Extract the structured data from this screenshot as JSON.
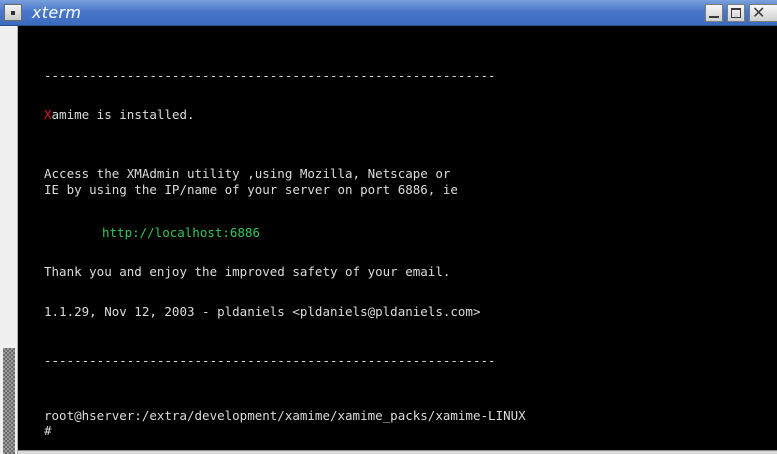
{
  "window": {
    "title": "xterm"
  },
  "terminal": {
    "separator1": "------------------------------------------------------------",
    "installed_prefix": "X",
    "installed_rest": "amime is installed.",
    "access_line1": "Access the XMAdmin utility ,using Mozilla, Netscape or",
    "access_line2": "IE by using the IP/name of your server on port 6886, ie",
    "url": "http://localhost:6886",
    "thanks": "Thank you and enjoy the improved safety of your email.",
    "version": "1.1.29, Nov 12, 2003 - pldaniels <pldaniels@pldaniels.com>",
    "separator2": "------------------------------------------------------------",
    "prompt": "root@hserver:/extra/development/xamime/xamime_packs/xamime-LINUX",
    "cursor_line": "#"
  },
  "colors": {
    "background": "#000000",
    "text": "#dcdcdc",
    "url": "#34c759",
    "accent_x": "#e01818",
    "titlebar": "#4a78c9"
  }
}
